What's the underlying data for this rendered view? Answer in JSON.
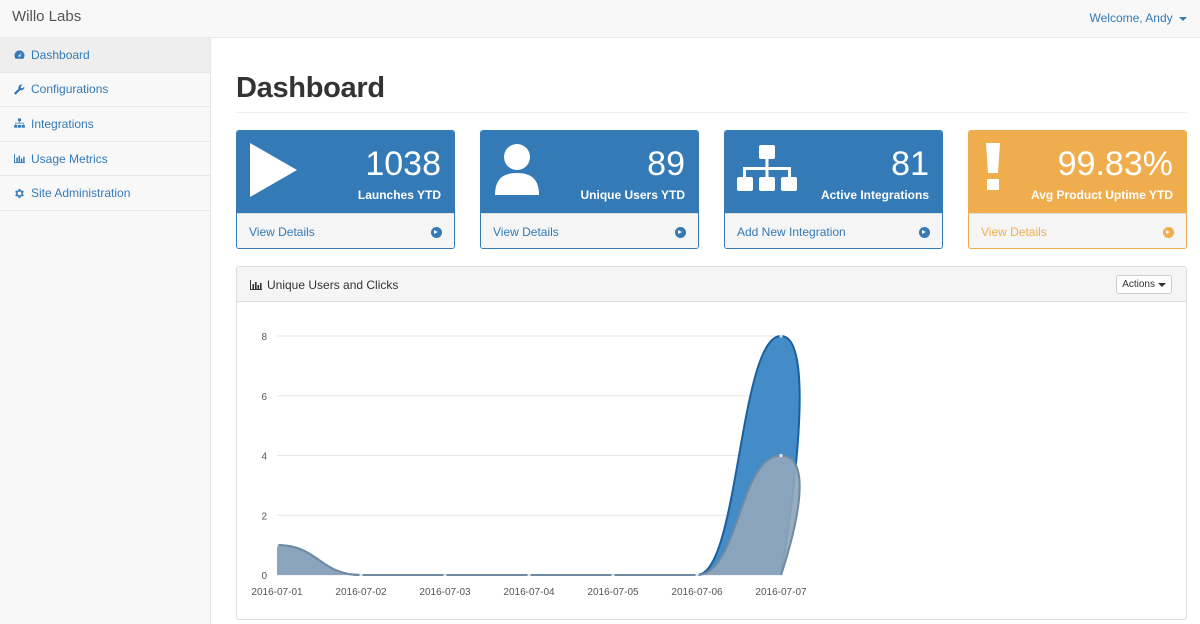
{
  "navbar": {
    "brand": "Willo Labs",
    "welcome": "Welcome, Andy"
  },
  "sidebar": {
    "items": [
      {
        "label": "Dashboard",
        "icon": "dashboard-icon",
        "active": true
      },
      {
        "label": "Configurations",
        "icon": "wrench-icon",
        "active": false
      },
      {
        "label": "Integrations",
        "icon": "sitemap-icon",
        "active": false
      },
      {
        "label": "Usage Metrics",
        "icon": "bar-chart-icon",
        "active": false
      },
      {
        "label": "Site Administration",
        "icon": "gear-icon",
        "active": false
      }
    ]
  },
  "page": {
    "title": "Dashboard"
  },
  "stats": [
    {
      "value": "1038",
      "label": "Launches YTD",
      "link": "View Details",
      "icon": "play-icon",
      "color": "#337ab7"
    },
    {
      "value": "89",
      "label": "Unique Users YTD",
      "link": "View Details",
      "icon": "user-icon",
      "color": "#337ab7"
    },
    {
      "value": "81",
      "label": "Active Integrations",
      "link": "Add New Integration",
      "icon": "sitemap-icon",
      "color": "#337ab7"
    },
    {
      "value": "99.83%",
      "label": "Avg Product Uptime YTD",
      "link": "View Details",
      "icon": "exclamation-icon",
      "color": "#f0ad4e"
    }
  ],
  "chart_panel": {
    "title": "Unique Users and Clicks",
    "actions_label": "Actions"
  },
  "chart_data": {
    "type": "area",
    "categories": [
      "2016-07-01",
      "2016-07-02",
      "2016-07-03",
      "2016-07-04",
      "2016-07-05",
      "2016-07-06",
      "2016-07-07"
    ],
    "series": [
      {
        "values": [
          1,
          0,
          0,
          0,
          0,
          0,
          8
        ],
        "color": "#2f7fc1"
      },
      {
        "values": [
          1,
          0,
          0,
          0,
          0,
          0,
          4
        ],
        "color": "#8fa6bb"
      }
    ],
    "ylim": [
      0,
      8
    ],
    "yticks": [
      0,
      2,
      4,
      6,
      8
    ],
    "grid": true
  }
}
